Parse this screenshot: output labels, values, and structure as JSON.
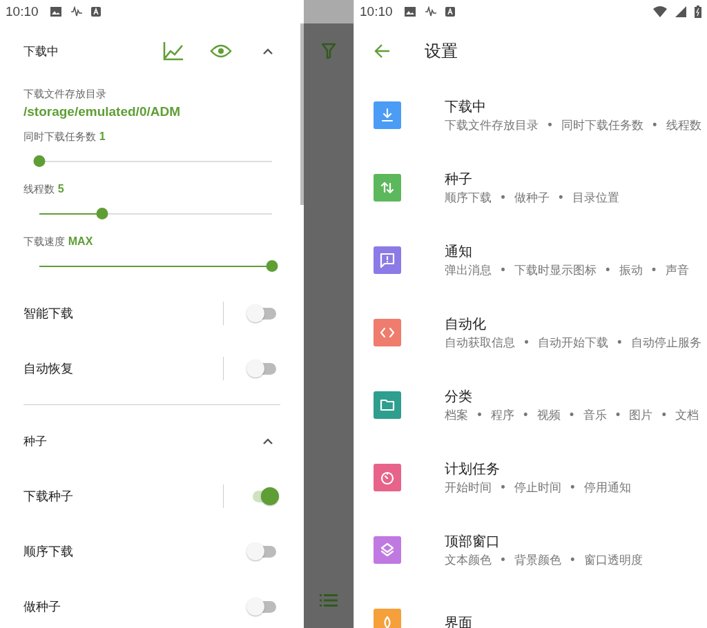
{
  "left_screen": {
    "status_bar": {
      "time": "10:10"
    },
    "sections": [
      {
        "title": "下载中",
        "expanded": true,
        "show_actions": true,
        "directory": {
          "label": "下载文件存放目录",
          "value": "/storage/emulated/0/ADM"
        },
        "sliders": [
          {
            "label": "同时下载任务数",
            "value": "1",
            "level": 0
          },
          {
            "label": "线程数",
            "value": "5",
            "level": 0.27
          },
          {
            "label": "下载速度",
            "value": "MAX",
            "level": 1
          }
        ],
        "toggles": [
          {
            "label": "智能下载",
            "on": false,
            "has_divider": true
          },
          {
            "label": "自动恢复",
            "on": false,
            "has_divider": true
          }
        ]
      },
      {
        "title": "种子",
        "expanded": true,
        "show_actions": false,
        "toggles": [
          {
            "label": "下载种子",
            "on": true,
            "has_divider": true
          },
          {
            "label": "顺序下载",
            "on": false,
            "has_divider": false
          },
          {
            "label": "做种子",
            "on": false,
            "has_divider": false
          }
        ]
      }
    ]
  },
  "right_screen": {
    "status_bar": {
      "time": "10:10"
    },
    "title": "设置",
    "items": [
      {
        "title": "下载中",
        "subtitle": "下载文件存放目录 • 同时下载任务数 • 线程数",
        "kind": "download",
        "color": "#4a9cf5"
      },
      {
        "title": "种子",
        "subtitle": "顺序下载 • 做种子 • 目录位置",
        "kind": "transfer",
        "color": "#5cb85c"
      },
      {
        "title": "通知",
        "subtitle": "弹出消息 • 下载时显示图标 • 振动 • 声音",
        "kind": "message",
        "color": "#8c7ae6"
      },
      {
        "title": "自动化",
        "subtitle": "自动获取信息 • 自动开始下载 • 自动停止服务",
        "kind": "code",
        "color": "#ef7c6c"
      },
      {
        "title": "分类",
        "subtitle": "档案 • 程序 • 视频 • 音乐 • 图片 • 文档",
        "kind": "folder",
        "color": "#2e9e8e"
      },
      {
        "title": "计划任务",
        "subtitle": "开始时间 • 停止时间 • 停用通知",
        "kind": "timer",
        "color": "#e8638a"
      },
      {
        "title": "顶部窗口",
        "subtitle": "文本颜色 • 背景颜色 • 窗口透明度",
        "kind": "layers",
        "color": "#c079e0"
      },
      {
        "title": "界面",
        "kind": "drop",
        "color": "#f5a03a"
      }
    ]
  }
}
